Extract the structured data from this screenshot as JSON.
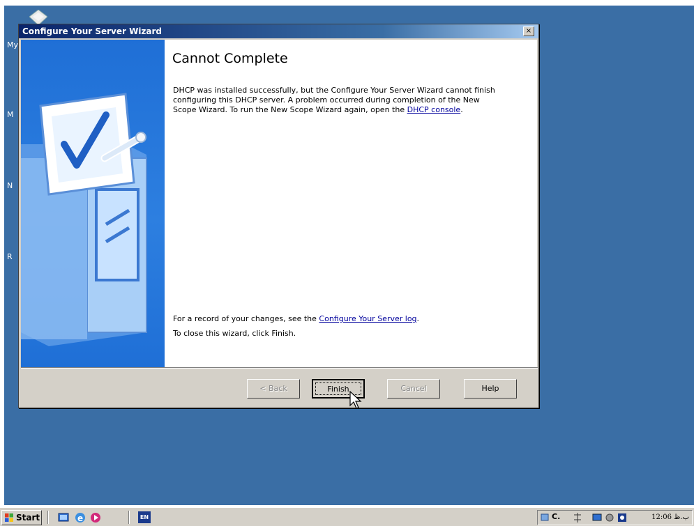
{
  "window": {
    "title": "Configure Your Server Wizard",
    "close_glyph": "×"
  },
  "page": {
    "heading": "Cannot Complete",
    "message_text": "DHCP was installed successfully, but the Configure Your Server Wizard cannot finish configuring this DHCP server. A problem occurred during completion of the New Scope Wizard. To run the New Scope Wizard again, open the ",
    "message_link": "DHCP console",
    "message_end": ".",
    "record_text": "For a record of your changes, see the ",
    "record_link": "Configure Your Server log",
    "record_end": ".",
    "close_text": "To close this wizard, click Finish."
  },
  "buttons": {
    "back": "< Back",
    "finish": "Finish",
    "cancel": "Cancel",
    "help": "Help"
  },
  "desktop": {
    "labels": [
      "My",
      "M",
      "N",
      "R"
    ]
  },
  "taskbar": {
    "start": "Start",
    "language": "EN",
    "tray_text": "C.",
    "clock": "12:06 ب.ظ"
  },
  "colors": {
    "desktop": "#3a6ea5",
    "title_gradient_start": "#0a246a",
    "wizard_panel": "#1f6fd6",
    "link": "#00009c"
  },
  "icons": {
    "wizard_art": "server-checklist-icon",
    "start_logo": "windows-flag-icon",
    "cursor": "mouse-pointer-icon"
  }
}
